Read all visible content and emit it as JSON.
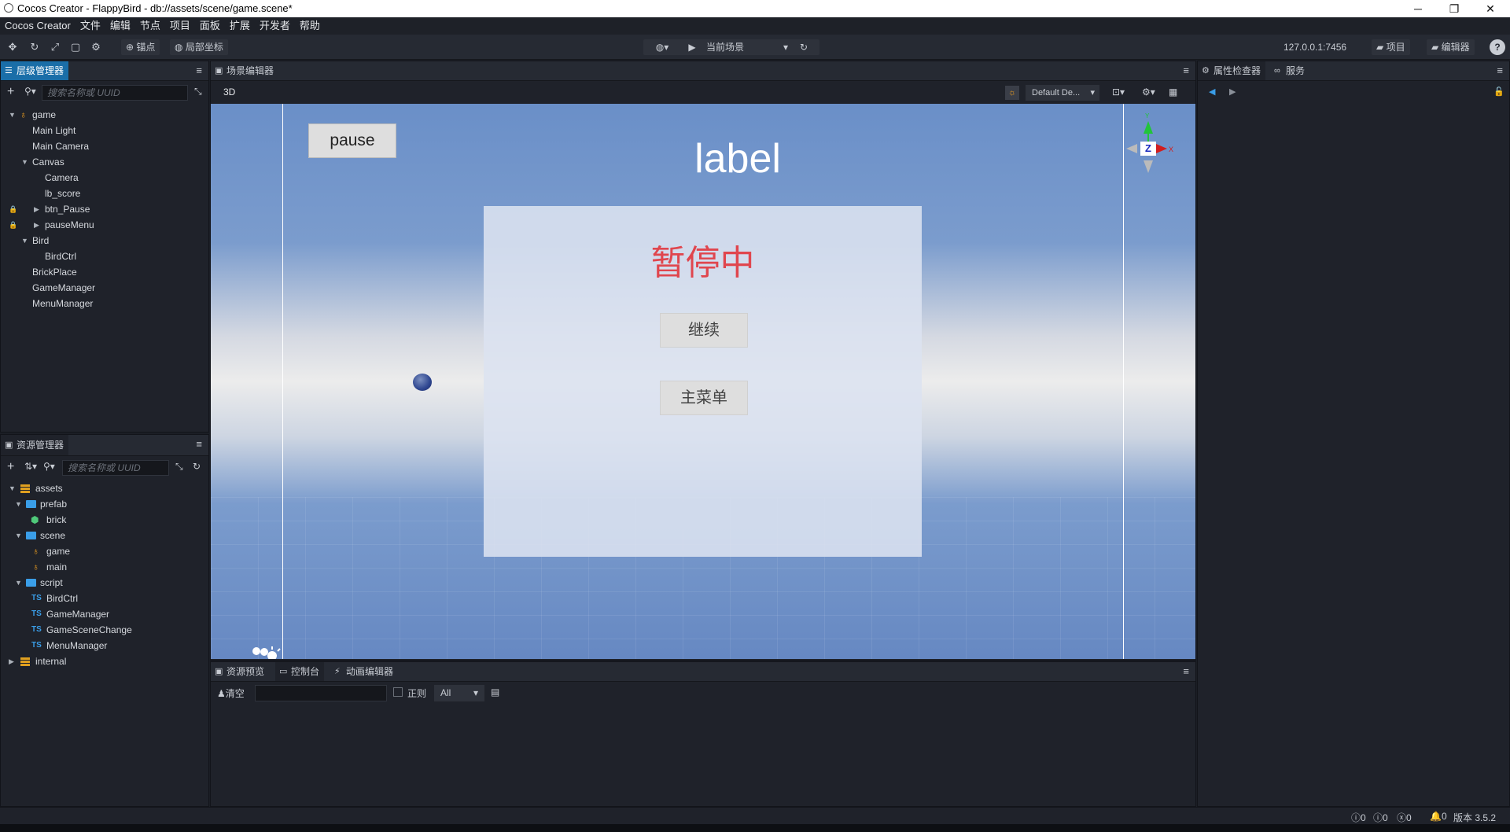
{
  "window": {
    "title": "Cocos Creator - FlappyBird - db://assets/scene/game.scene*",
    "minimize": "─",
    "restore": "❐",
    "close": "✕"
  },
  "menu": [
    "Cocos Creator",
    "文件",
    "编辑",
    "节点",
    "项目",
    "面板",
    "扩展",
    "开发者",
    "帮助"
  ],
  "toolbar": {
    "anchor_label": "锚点",
    "local_coord_label": "局部坐标",
    "scene_select": "当前场景",
    "address": "127.0.0.1:7456",
    "project_btn": "项目",
    "editor_btn": "编辑器"
  },
  "hierarchy": {
    "tab_label": "层级管理器",
    "search_placeholder": "搜索名称或 UUID",
    "items": [
      "game",
      "Main Light",
      "Main Camera",
      "Canvas",
      "Camera",
      "lb_score",
      "btn_Pause",
      "pauseMenu",
      "Bird",
      "BirdCtrl",
      "BrickPlace",
      "GameManager",
      "MenuManager"
    ]
  },
  "assets": {
    "tab_label": "资源管理器",
    "search_placeholder": "搜索名称或 UUID",
    "items": [
      "assets",
      "prefab",
      "brick",
      "scene",
      "game",
      "main",
      "script",
      "BirdCtrl",
      "GameManager",
      "GameSceneChange",
      "MenuManager",
      "internal"
    ],
    "ts_badge": "TS"
  },
  "scene_editor": {
    "tab_label": "场景编辑器",
    "mode_3d": "3D",
    "camera_select": "Default De...",
    "pause_button": "pause",
    "label_text": "label",
    "pause_menu_title": "暂停中",
    "continue_button": "继续",
    "main_menu_button": "主菜单",
    "gizmo": {
      "y": "Y",
      "z": "Z",
      "x": "X"
    }
  },
  "bottom": {
    "tabs": [
      "资源预览",
      "控制台",
      "动画编辑器"
    ],
    "clear_label": "清空",
    "regex_label": "正则",
    "level_select": "All"
  },
  "inspector": {
    "tab_label": "属性检查器",
    "service_tab": "服务"
  },
  "status": {
    "info_count": "0",
    "warn_count": "0",
    "error_count": "0",
    "notify_count": "0",
    "version": "版本 3.5.2"
  }
}
